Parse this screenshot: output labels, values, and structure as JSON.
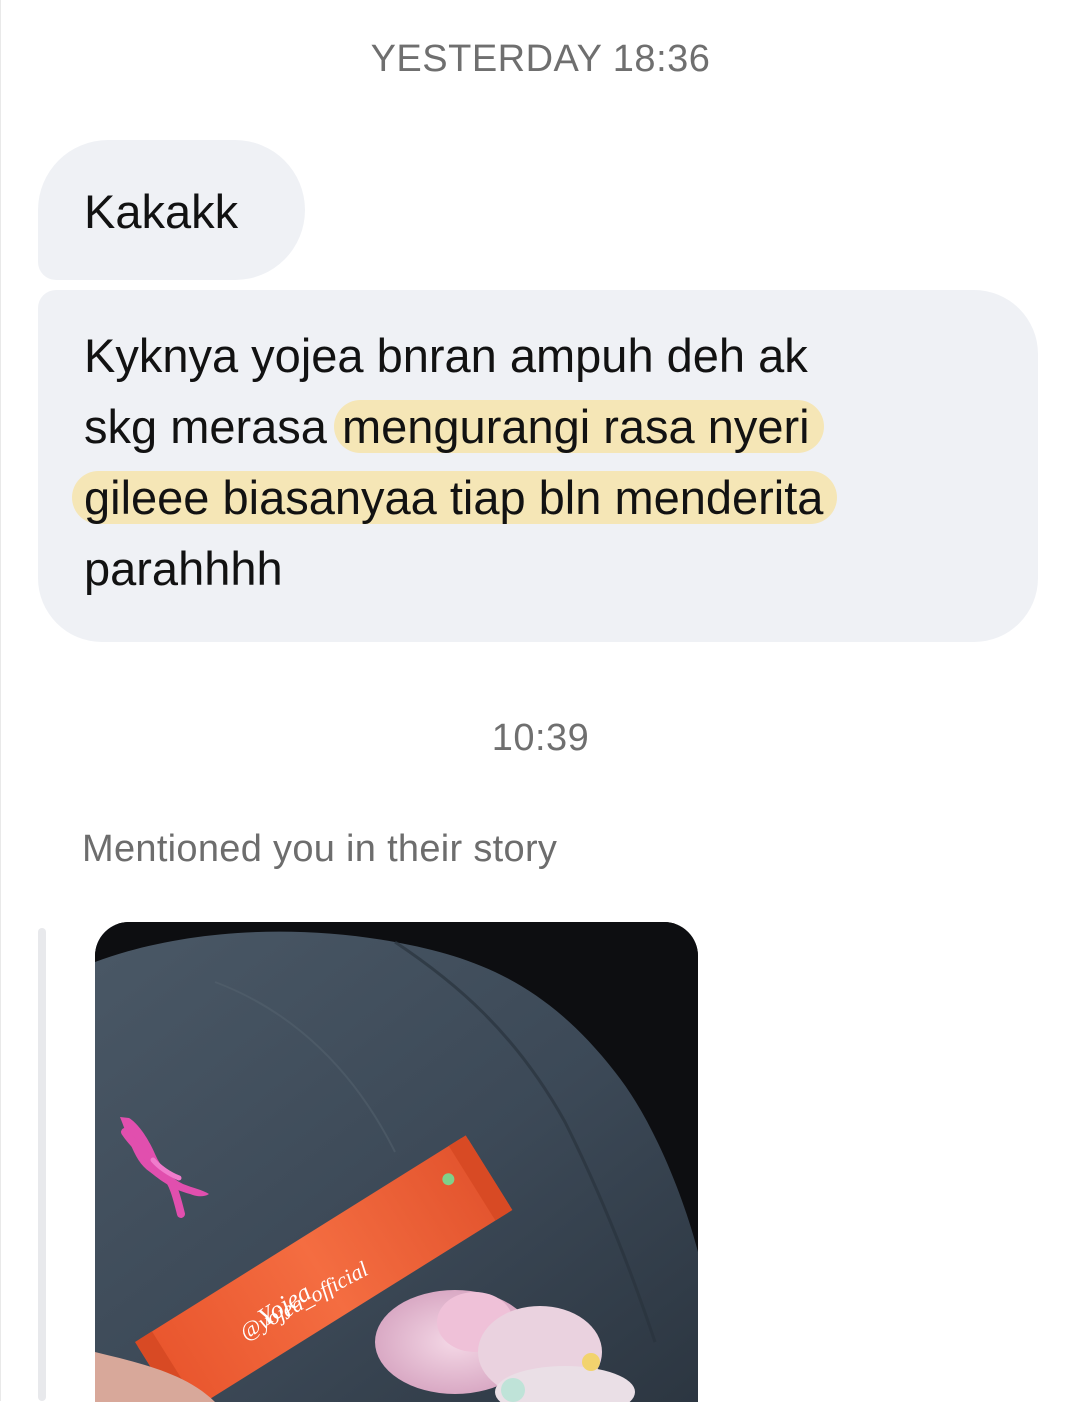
{
  "conversation": {
    "timestamp_1": "YESTERDAY 18:36",
    "timestamp_2": "10:39"
  },
  "messages": [
    {
      "text": "Kakakk"
    },
    {
      "lines": [
        {
          "plain": "Kyknya yojea bnran ampuh deh ak",
          "highlight": ""
        },
        {
          "plain": "skg merasa ",
          "highlight": "mengurangi rasa nyeri"
        },
        {
          "plain": "",
          "highlight": "gileee biasanyaa tiap bln menderita"
        },
        {
          "plain": "parahhhh",
          "highlight": ""
        }
      ]
    }
  ],
  "story_mention": {
    "label": "Mentioned you in their story",
    "photo": {
      "packet_brand": "Yojea",
      "handle_tag": "@yojea_official"
    }
  },
  "colors": {
    "bubble_bg": "#eff1f5",
    "highlight": "#f5e6b6",
    "timestamp_text": "#6f6f6f",
    "packet_orange": "#f0643a"
  }
}
